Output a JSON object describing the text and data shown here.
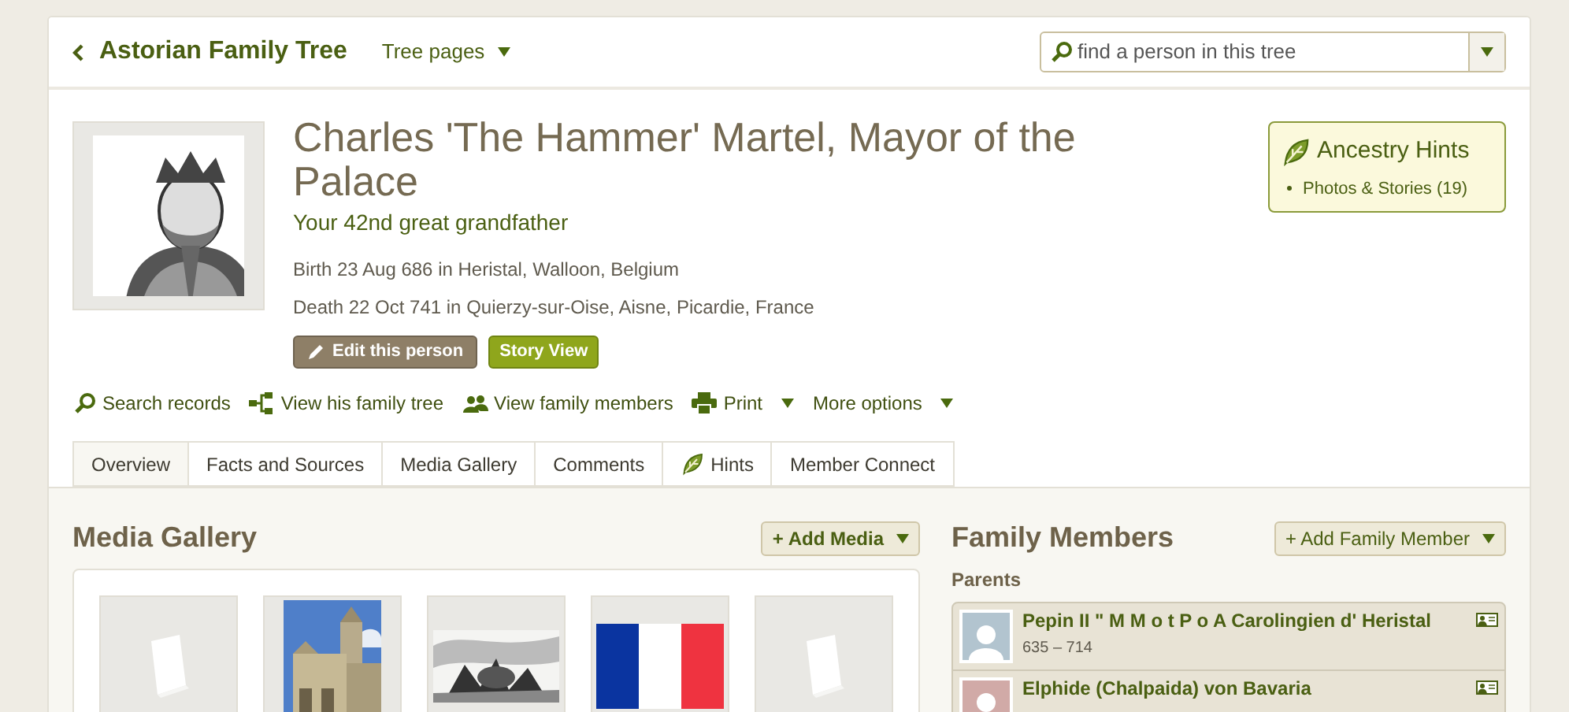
{
  "header": {
    "back_title": "Astorian Family Tree",
    "tree_pages": "Tree pages",
    "search": {
      "placeholder": "find a person in this tree"
    }
  },
  "person": {
    "name": "Charles 'The Hammer' Martel, Mayor of the Palace",
    "relation": "Your 42nd great grandfather",
    "birth": "Birth 23 Aug 686 in Heristal, Walloon, Belgium",
    "death": "Death 22 Oct 741 in Quierzy-sur-Oise, Aisne, Picardie, France",
    "buttons": [
      {
        "label": "Edit this person",
        "kind": "edit"
      },
      {
        "label": "Story View",
        "kind": "story"
      }
    ]
  },
  "hints": {
    "title": "Ancestry Hints",
    "items": [
      "Photos & Stories (19)"
    ]
  },
  "actions": [
    {
      "label": "Search records",
      "kind": "search",
      "dropdown": false
    },
    {
      "label": "View his family tree",
      "kind": "tree",
      "dropdown": false
    },
    {
      "label": "View family members",
      "kind": "people",
      "dropdown": false
    },
    {
      "label": "Print",
      "kind": "print",
      "dropdown": true
    },
    {
      "label": "More options",
      "kind": "none",
      "dropdown": true
    }
  ],
  "tabs": [
    {
      "label": "Overview",
      "selected": true,
      "icon": false
    },
    {
      "label": "Facts and Sources",
      "selected": false,
      "icon": false
    },
    {
      "label": "Media Gallery",
      "selected": false,
      "icon": false
    },
    {
      "label": "Comments",
      "selected": false,
      "icon": false
    },
    {
      "label": "Hints",
      "selected": false,
      "icon": true
    },
    {
      "label": "Member Connect",
      "selected": false,
      "icon": false
    }
  ],
  "media": {
    "title": "Media Gallery",
    "add_button": "+ Add Media",
    "items": [
      {
        "kind": "story"
      },
      {
        "kind": "picture"
      },
      {
        "kind": "engraving"
      },
      {
        "kind": "flag"
      },
      {
        "kind": "story"
      }
    ]
  },
  "family": {
    "title": "Family Members",
    "add_button": "+ Add Family Member",
    "section": "Parents",
    "members": [
      {
        "name": "Pepin II \" M M o t P o A Carolingien d' Heristal",
        "years": "635 – 714",
        "kind": "male"
      },
      {
        "name": "Elphide (Chalpaida) von Bavaria",
        "kind": "female"
      }
    ]
  }
}
